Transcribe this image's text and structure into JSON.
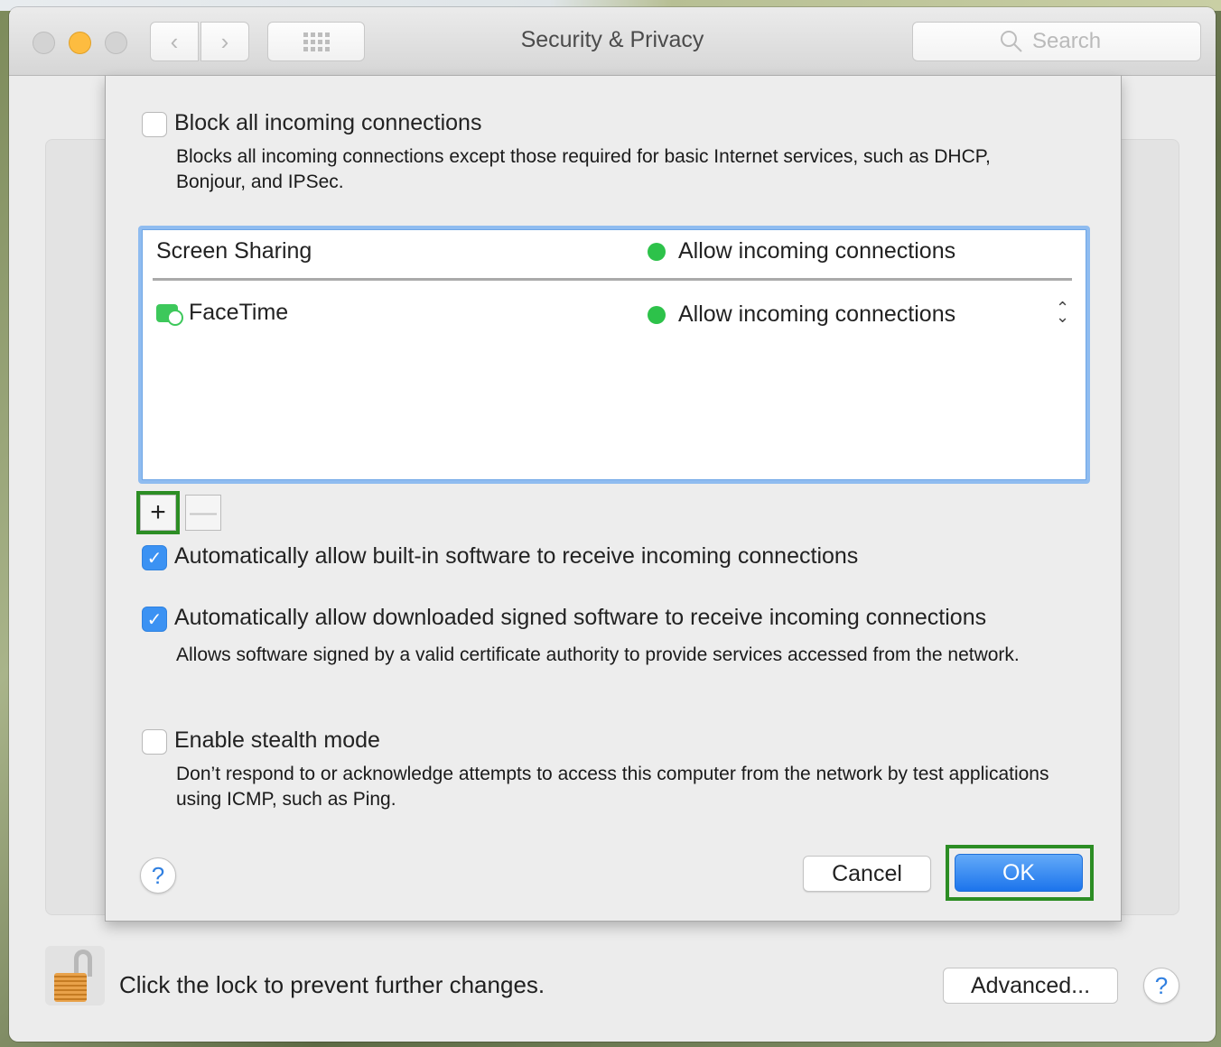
{
  "window": {
    "title": "Security & Privacy",
    "search_placeholder": "Search",
    "back_icon": "‹",
    "forward_icon": "›"
  },
  "firewall_options": {
    "block_all": {
      "label": "Block all incoming connections",
      "checked": false,
      "description": "Blocks all incoming connections except those required for basic Internet services, such as DHCP, Bonjour, and IPSec."
    },
    "app_list": [
      {
        "name": "Screen Sharing",
        "status": "Allow incoming connections",
        "status_color": "#2dc24a",
        "has_stepper": false
      },
      {
        "name": "FaceTime",
        "status": "Allow incoming connections",
        "status_color": "#2dc24a",
        "has_stepper": true
      }
    ],
    "add_button": "+",
    "remove_button": "—",
    "auto_builtin": {
      "label": "Automatically allow built-in software to receive incoming connections",
      "checked": true
    },
    "auto_signed": {
      "label": "Automatically allow downloaded signed software to receive incoming connections",
      "checked": true,
      "description": "Allows software signed by a valid certificate authority to provide services accessed from the network."
    },
    "stealth": {
      "label": "Enable stealth mode",
      "checked": false,
      "description": "Don’t respond to or acknowledge attempts to access this computer from the network by test applications using ICMP, such as Ping."
    },
    "help_label": "?",
    "cancel_label": "Cancel",
    "ok_label": "OK"
  },
  "footer": {
    "lock_text": "Click the lock to prevent further changes.",
    "advanced_label": "Advanced...",
    "help_label": "?"
  },
  "colors": {
    "accent": "#3b92f3",
    "highlight": "#2c8d24",
    "status_green": "#2dc24a"
  }
}
